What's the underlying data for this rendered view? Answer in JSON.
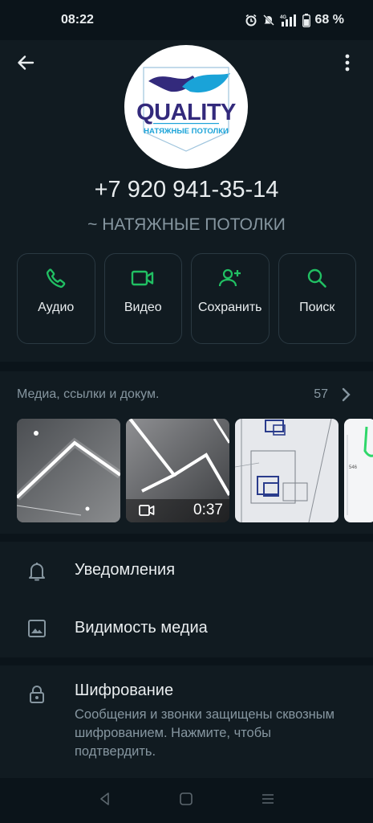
{
  "status_bar": {
    "time": "08:22",
    "network": "4G",
    "battery": "68 %",
    "icons": [
      "alarm-icon",
      "mute-icon",
      "signal-icon",
      "battery-icon"
    ]
  },
  "header": {
    "back_icon": "arrow-left-icon",
    "menu_icon": "more-vertical-icon",
    "logo": {
      "main": "QUALITY",
      "sub": "НАТЯЖНЫЕ ПОТОЛКИ"
    },
    "phone": "+7 920 941-35-14",
    "subtitle": "~ НАТЯЖНЫЕ ПОТОЛКИ"
  },
  "actions": [
    {
      "label": "Аудио",
      "icon": "phone-icon"
    },
    {
      "label": "Видео",
      "icon": "video-icon"
    },
    {
      "label": "Сохранить",
      "icon": "add-person-icon"
    },
    {
      "label": "Поиск",
      "icon": "search-icon"
    }
  ],
  "media": {
    "title": "Медиа, ссылки и докум.",
    "count": "57",
    "video_duration": "0:37"
  },
  "settings": {
    "notifications": "Уведомления",
    "media_visibility": "Видимость медиа"
  },
  "encryption": {
    "title": "Шифрование",
    "description": "Сообщения и звонки защищены сквозным шифрованием. Нажмите, чтобы подтвердить."
  },
  "colors": {
    "accent": "#21c063",
    "background": "#0b141a",
    "surface": "#111b21",
    "secondary_text": "#8696a0"
  }
}
